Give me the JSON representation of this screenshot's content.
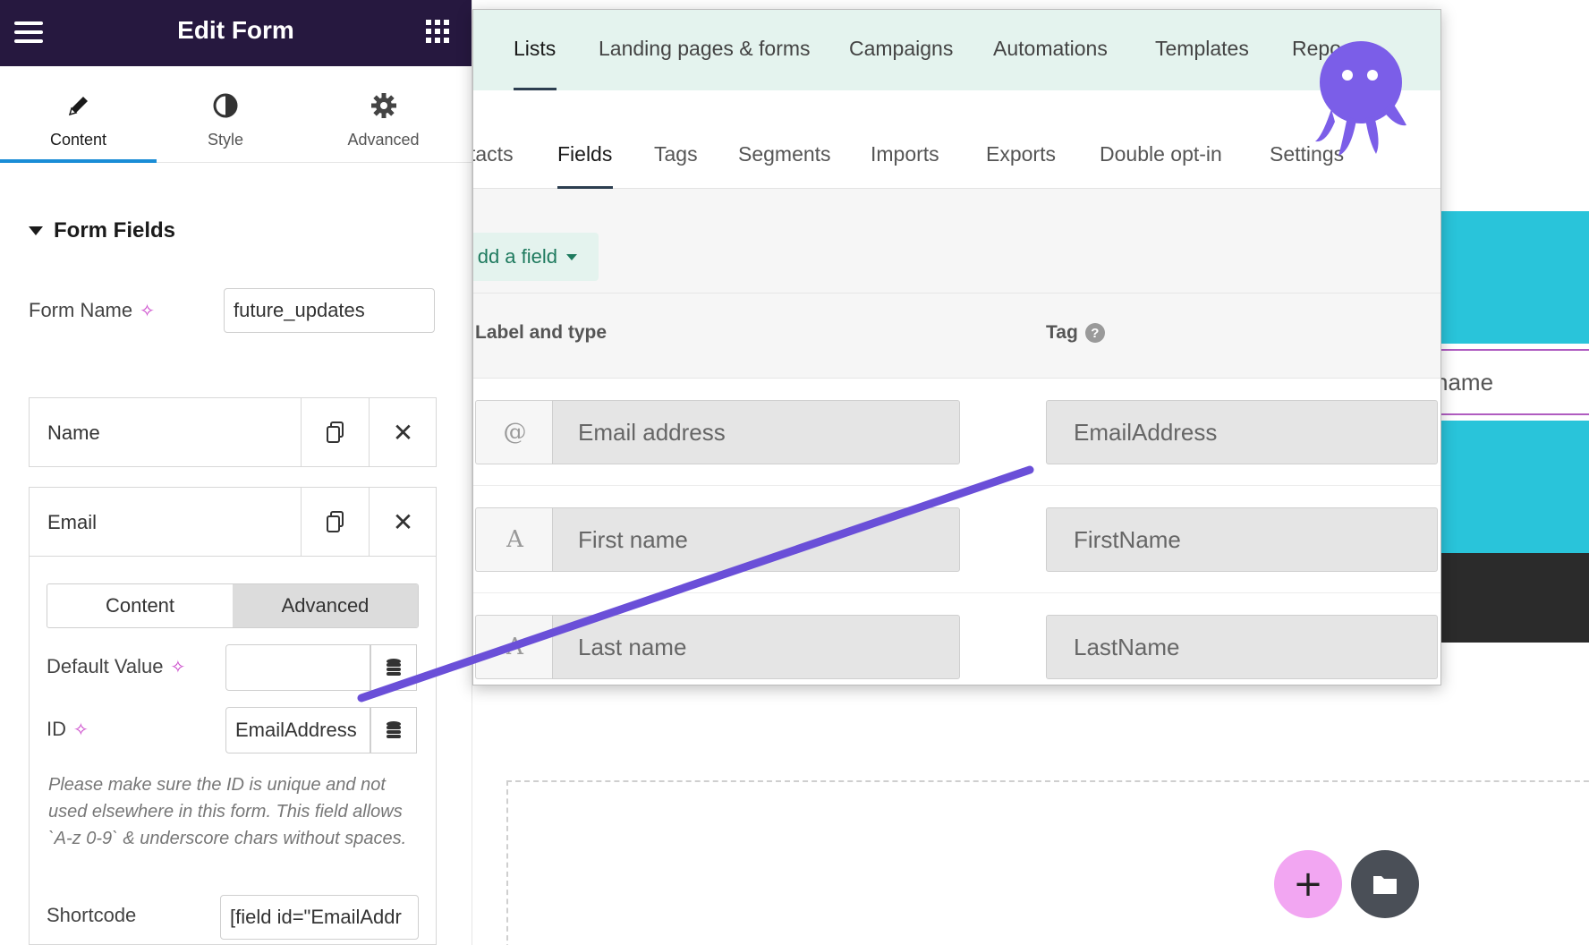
{
  "panel": {
    "title": "Edit Form",
    "menu_icon": "hamburger-icon",
    "apps_icon": "grid-icon",
    "tabs": [
      {
        "label": "Content",
        "icon": "pencil-icon",
        "active": true
      },
      {
        "label": "Style",
        "icon": "contrast-icon",
        "active": false
      },
      {
        "label": "Advanced",
        "icon": "gear-icon",
        "active": false
      }
    ],
    "section_title": "Form Fields",
    "form_name_label": "Form Name",
    "form_name_value": "future_updates",
    "fields": [
      {
        "title": "Name"
      },
      {
        "title": "Email"
      }
    ],
    "email_settings": {
      "segment": [
        "Content",
        "Advanced"
      ],
      "active_segment": "Advanced",
      "default_value_label": "Default Value",
      "default_value": "",
      "id_label": "ID",
      "id_value": "EmailAddress",
      "note": "Please make sure the ID is unique and not used elsewhere in this form. This field allows `A-z 0-9` & underscore chars without spaces.",
      "shortcode_label": "Shortcode",
      "shortcode_value": "[field id=\"EmailAddr"
    },
    "accent_color": "#1a8dd6",
    "header_color": "#26183f"
  },
  "octopus": {
    "top_nav": [
      "Lists",
      "Landing pages & forms",
      "Campaigns",
      "Automations",
      "Templates",
      "Repo"
    ],
    "active_top": "Lists",
    "sub_nav": [
      "tacts",
      "Fields",
      "Tags",
      "Segments",
      "Imports",
      "Exports",
      "Double opt-in",
      "Settings"
    ],
    "active_sub": "Fields",
    "add_field_label": "dd a field",
    "table_headers": {
      "label_type": "Label and type",
      "tag": "Tag"
    },
    "rows": [
      {
        "type_icon": "@",
        "label": "Email address",
        "tag": "EmailAddress"
      },
      {
        "type_icon": "A",
        "label": "First name",
        "tag": "FirstName"
      },
      {
        "type_icon": "A",
        "label": "Last name",
        "tag": "LastName"
      }
    ],
    "mascot_color": "#7b5ee8"
  },
  "canvas": {
    "field_text": "name",
    "add_icon": "plus-icon",
    "folder_icon": "folder-icon",
    "accent_cyan": "#29c4da",
    "add_button_color": "#f2a6f2"
  },
  "connector_color": "#6a4fd8"
}
